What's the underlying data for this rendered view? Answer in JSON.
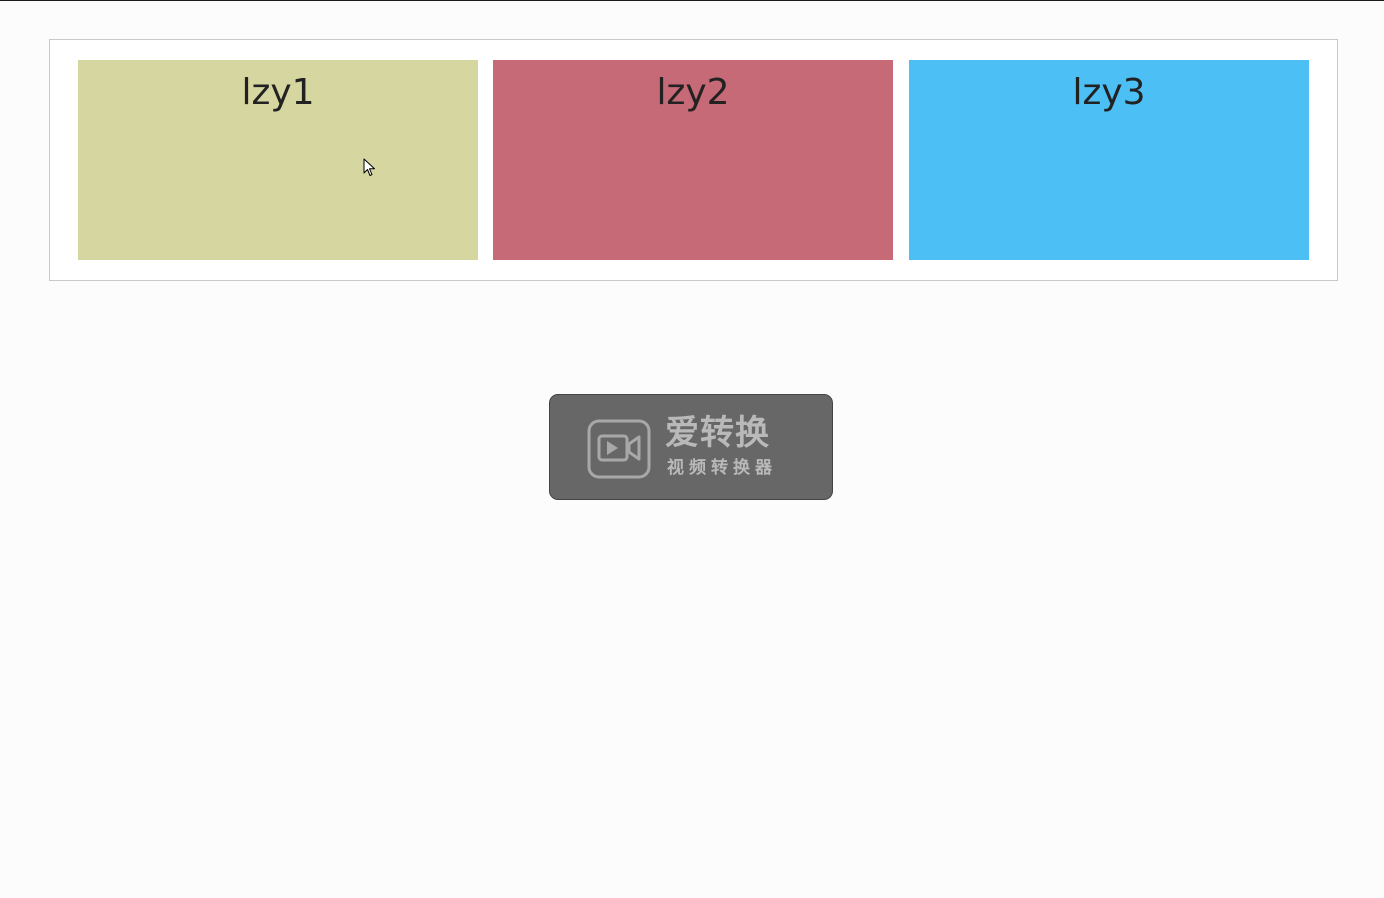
{
  "cards": [
    {
      "label": "lzy1",
      "color": "#d6d6a0"
    },
    {
      "label": "lzy2",
      "color": "#c56a76"
    },
    {
      "label": "lzy3",
      "color": "#4cbff4"
    }
  ],
  "watermark": {
    "title": "爱转换",
    "subtitle": "视频转换器",
    "icon": "video-camera-icon"
  },
  "colors": {
    "page_background": "#fcfcfc",
    "container_border": "#c9c9c9",
    "watermark_background": "#5a5a5a",
    "watermark_text": "#b9b9b9"
  }
}
